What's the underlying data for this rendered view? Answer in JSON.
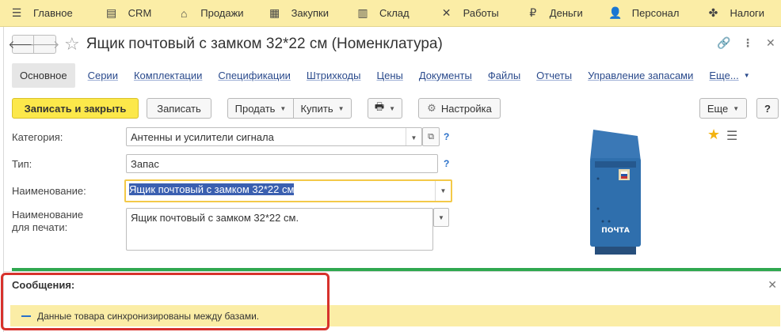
{
  "sections": [
    {
      "icon": "menu-icon",
      "label": "Главное"
    },
    {
      "icon": "crm-icon",
      "label": "CRM"
    },
    {
      "icon": "basket-icon",
      "label": "Продажи"
    },
    {
      "icon": "purchases-icon",
      "label": "Закупки"
    },
    {
      "icon": "warehouse-icon",
      "label": "Склад"
    },
    {
      "icon": "tools-icon",
      "label": "Работы"
    },
    {
      "icon": "money-icon",
      "label": "Деньги"
    },
    {
      "icon": "person-icon",
      "label": "Персонал"
    },
    {
      "icon": "emblem-icon",
      "label": "Налоги"
    }
  ],
  "window": {
    "title": "Ящик почтовый с замком 32*22 см (Номенклатура)"
  },
  "tabs": [
    "Основное",
    "Серии",
    "Комплектации",
    "Спецификации",
    "Штрихкоды",
    "Цены",
    "Документы",
    "Файлы",
    "Отчеты",
    "Управление запасами",
    "Еще..."
  ],
  "toolbar": {
    "save_close": "Записать и закрыть",
    "save": "Записать",
    "sell": "Продать",
    "buy": "Купить",
    "settings": "Настройка",
    "more": "Еще",
    "help": "?"
  },
  "form": {
    "category_label": "Категория:",
    "category_value": "Антенны и усилители сигнала",
    "type_label": "Тип:",
    "type_value": "Запас",
    "name_label": "Наименование:",
    "name_value": "Ящик почтовый с замком 32*22 см",
    "print_label_1": "Наименование",
    "print_label_2": "для печати:",
    "print_value": "Ящик почтовый с замком 32*22 см.",
    "hint": "?"
  },
  "picture": {
    "caption": "ПОЧТА"
  },
  "messages": {
    "title": "Сообщения:",
    "items": [
      "Данные товара синхронизированы между базами."
    ]
  },
  "colors": {
    "section_bar": "#fbeda6",
    "primary_button": "#fce84a",
    "accent_blue": "#2a70c9",
    "highlight_red": "#d7322c",
    "green_bar": "#2fa84f"
  }
}
